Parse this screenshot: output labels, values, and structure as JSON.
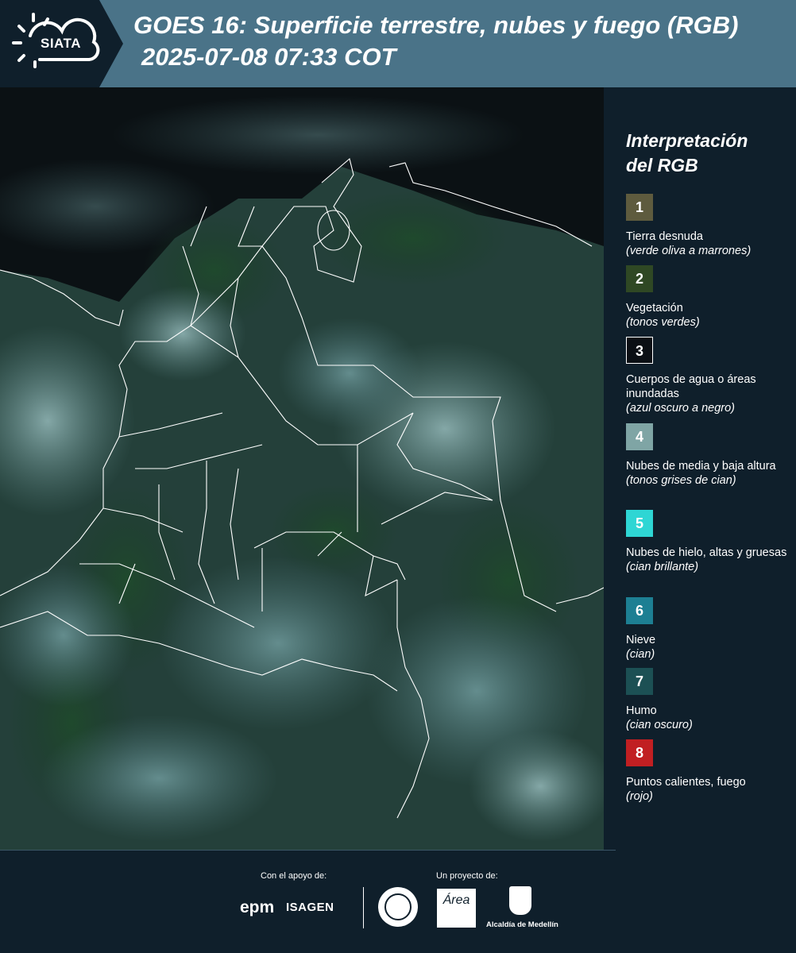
{
  "header": {
    "logo_text": "SIATA",
    "title_line1": "GOES 16: Superficie terrestre, nubes y fuego (RGB)",
    "title_line2": "2025-07-08 07:33 COT",
    "background_color": "#4a7388"
  },
  "legend": {
    "title_line1": "Interpretación",
    "title_line2": "del RGB",
    "items": [
      {
        "number": "1",
        "label": "Tierra desnuda",
        "sub": "(verde oliva a marrones)",
        "color": "#5e5b3e"
      },
      {
        "number": "2",
        "label": "Vegetación",
        "sub": "(tonos verdes)",
        "color": "#2f4824"
      },
      {
        "number": "3",
        "label": "Cuerpos de agua o áreas inundadas",
        "sub": "(azul oscuro a negro)",
        "color": "#0b0f14"
      },
      {
        "number": "4",
        "label": "Nubes de media y baja altura",
        "sub": "(tonos grises de cian)",
        "color": "#7fa5a5"
      },
      {
        "number": "5",
        "label": "Nubes de hielo, altas y gruesas",
        "sub": "(cian brillante)",
        "color": "#2ed6d4"
      },
      {
        "number": "6",
        "label": "Nieve",
        "sub": "(cian)",
        "color": "#1d7f93"
      },
      {
        "number": "7",
        "label": "Humo",
        "sub": "(cian oscuro)",
        "color": "#1c5054"
      },
      {
        "number": "8",
        "label": "Puntos calientes, fuego",
        "sub": "(rojo)",
        "color": "#c11f22"
      }
    ]
  },
  "footer": {
    "support_label": "Con el apoyo de:",
    "project_label": "Un proyecto de:",
    "sponsors": [
      "epm",
      "ISAGEN"
    ],
    "partners": [
      "Área Metropolitana Valle de Aburrá",
      "Alcaldía de Medellín"
    ],
    "alcaldia_label": "Alcaldía de Medellín",
    "area_logo_text": "Área"
  }
}
